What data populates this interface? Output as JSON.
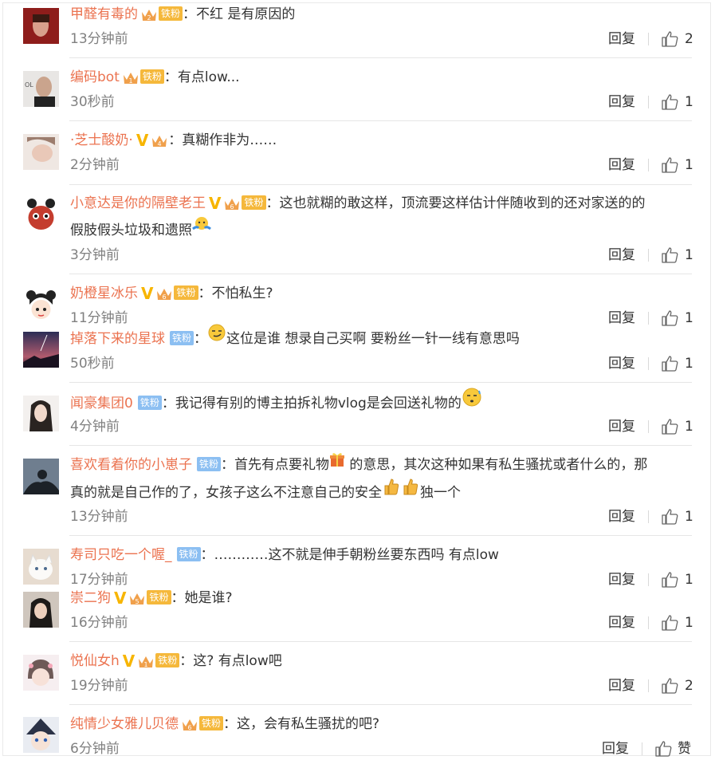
{
  "actions": {
    "reply_label": "回复",
    "like_fallback": "赞"
  },
  "fan_badge_label": "铁粉",
  "comments": [
    {
      "username": "甲醛有毒的",
      "vip": false,
      "crown": true,
      "crown_level": "2",
      "fan": true,
      "fan_style": "gold",
      "text": "不红 是有原因的",
      "time": "13分钟前",
      "likes": "2"
    },
    {
      "username": "编码bot",
      "vip": false,
      "crown": true,
      "crown_level": "1",
      "fan": true,
      "fan_style": "gold",
      "text": "有点low...",
      "time": "30秒前",
      "likes": "1"
    },
    {
      "username": "·芝士酸奶·",
      "vip": true,
      "crown": true,
      "crown_level": "4",
      "fan": false,
      "text": "真糊作非为……",
      "time": "2分钟前",
      "likes": "1"
    },
    {
      "username": "小意达是你的隔壁老王",
      "vip": true,
      "crown": true,
      "crown_level": "6",
      "fan": true,
      "fan_style": "gold",
      "text": "这也就糊的敢这样，顶流要这样估计伴随收到的还对家送的的",
      "text2": "假肢假头垃圾和遗照",
      "time": "3分钟前",
      "likes": "1"
    },
    {
      "username": "奶橙星冰乐",
      "vip": true,
      "crown": true,
      "crown_level": "6",
      "fan": true,
      "fan_style": "gold",
      "text": "不怕私生?",
      "time": "11分钟前",
      "likes": "1"
    },
    {
      "username": "掉落下来的星球",
      "vip": false,
      "crown": false,
      "fan": true,
      "fan_style": "blue",
      "text": "这位是谁  想录自己买啊 要粉丝一针一线有意思吗",
      "time": "50秒前",
      "likes": "1"
    },
    {
      "username": "闻豪集团0",
      "vip": false,
      "crown": false,
      "fan": true,
      "fan_style": "blue",
      "text": "我记得有别的博主拍拆礼物vlog是会回送礼物的",
      "time": "4分钟前",
      "likes": "1"
    },
    {
      "username": "喜欢看着你的小崽子",
      "vip": false,
      "crown": false,
      "fan": true,
      "fan_style": "blue",
      "text": "首先有点要礼物",
      "text_after": " 的意思，其次这种如果有私生骚扰或者什么的，那",
      "text2": "真的就是自己作的了，女孩子这么不注意自己的安全",
      "text2_after": "独一个",
      "time": "13分钟前",
      "likes": "1"
    },
    {
      "username": "寿司只吃一个喔_",
      "vip": false,
      "crown": false,
      "fan": true,
      "fan_style": "blue",
      "text": "…………这不就是伸手朝粉丝要东西吗 有点low",
      "time": "17分钟前",
      "likes": "1"
    },
    {
      "username": "崇二狗",
      "vip": true,
      "crown": true,
      "crown_level": "5",
      "fan": true,
      "fan_style": "gold",
      "text": "她是谁?",
      "time": "16分钟前",
      "likes": "1"
    },
    {
      "username": "悦仙女h",
      "vip": true,
      "crown": true,
      "crown_level": "1",
      "fan": true,
      "fan_style": "gold",
      "text": "这? 有点low吧",
      "time": "19分钟前",
      "likes": "2"
    },
    {
      "username": "纯情少女雅儿贝德",
      "vip": false,
      "crown": true,
      "crown_level": "6",
      "fan": true,
      "fan_style": "gold",
      "text": "这，会有私生骚扰的吧?",
      "time": "6分钟前",
      "likes": "赞"
    }
  ]
}
